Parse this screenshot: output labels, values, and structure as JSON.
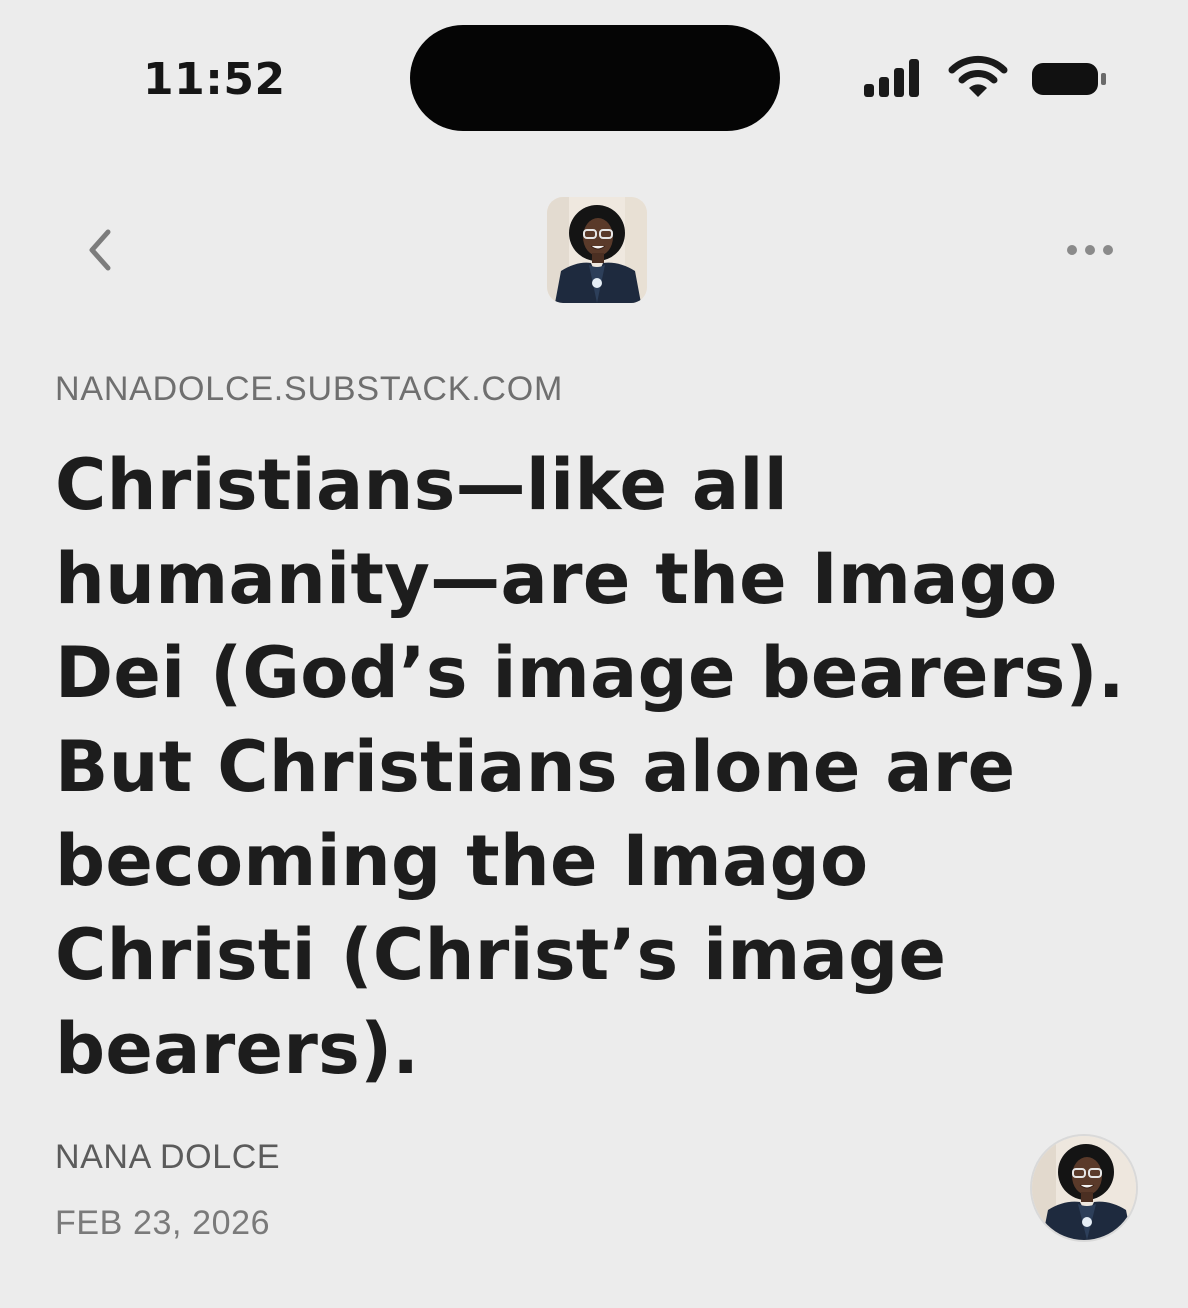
{
  "status_bar": {
    "time": "11:52",
    "icons": [
      "cellular-signal-icon",
      "wifi-icon",
      "battery-icon"
    ]
  },
  "header": {
    "back_icon": "chevron-left-icon",
    "avatar_icon": "author-photo",
    "more_icon": "ellipsis-icon"
  },
  "post": {
    "publication": "NANADOLCE.SUBSTACK.COM",
    "quote": "Christians—like all humanity—are the Imago Dei (God’s image bearers). But Christians alone are becoming the Imago Christi (Christ’s image bearers).",
    "author": "NANA DOLCE",
    "date": "FEB 23, 2026"
  },
  "colors": {
    "background": "#ececec",
    "text": "#1d1d1d",
    "muted": "#6f6f6f"
  }
}
